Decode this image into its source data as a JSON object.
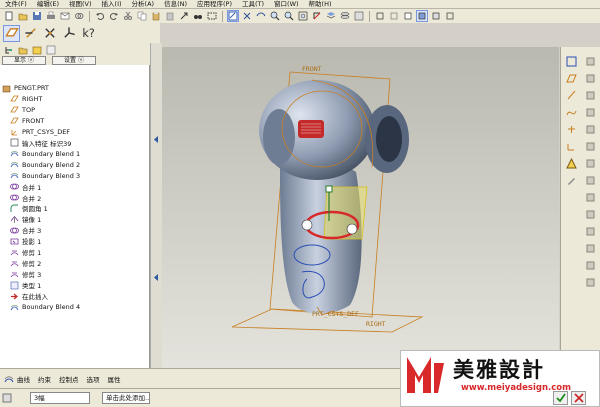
{
  "menu": [
    "文件(F)",
    "编辑(E)",
    "视图(V)",
    "插入(I)",
    "分析(A)",
    "信息(N)",
    "应用程序(P)",
    "工具(T)",
    "窗口(W)",
    "帮助(H)"
  ],
  "panel": {
    "tab_show": "显示 ⓥ",
    "tab_settings": "设置 ⓥ"
  },
  "tree": [
    {
      "label": "PENGT.PRT",
      "icon": "part-icon"
    },
    {
      "label": "RIGHT",
      "icon": "datum-plane-icon"
    },
    {
      "label": "TOP",
      "icon": "datum-plane-icon"
    },
    {
      "label": "FRONT",
      "icon": "datum-plane-icon"
    },
    {
      "label": "PRT_CSYS_DEF",
      "icon": "csys-icon"
    },
    {
      "label": "输入特征 标识39",
      "icon": "import-feature-icon"
    },
    {
      "label": "Boundary Blend 1",
      "icon": "boundary-blend-icon"
    },
    {
      "label": "Boundary Blend 2",
      "icon": "boundary-blend-icon"
    },
    {
      "label": "Boundary Blend 3",
      "icon": "boundary-blend-icon"
    },
    {
      "label": "合并 1",
      "icon": "merge-icon"
    },
    {
      "label": "合并 2",
      "icon": "merge-icon"
    },
    {
      "label": "倒圆角 1",
      "icon": "round-icon"
    },
    {
      "label": "镜像 1",
      "icon": "mirror-icon"
    },
    {
      "label": "合并 3",
      "icon": "merge-icon"
    },
    {
      "label": "投影 1",
      "icon": "projection-icon"
    },
    {
      "label": "修剪 1",
      "icon": "trim-icon"
    },
    {
      "label": "修剪 2",
      "icon": "trim-icon"
    },
    {
      "label": "修剪 3",
      "icon": "trim-icon"
    },
    {
      "label": "类型 1",
      "icon": "type-icon"
    },
    {
      "label": "在此插入",
      "icon": "insert-here-icon"
    },
    {
      "label": "Boundary Blend 4",
      "icon": "boundary-blend-icon"
    }
  ],
  "viewport": {
    "label_front": "FRONT",
    "label_csys": "PRT_CSYS_DEF",
    "label_right": "RIGHT"
  },
  "dashboard": [
    "曲线",
    "约束",
    "控制点",
    "选项",
    "属性"
  ],
  "status": {
    "mode": "3幅",
    "hint": "单击此处添加..."
  },
  "watermark": {
    "brand_cn": "美雅設計",
    "url": "www.meiyadesign.com"
  },
  "colors": {
    "accent_red": "#d8282a",
    "curve_orange": "#c87f20",
    "select_yellow": "#e9e26a"
  }
}
